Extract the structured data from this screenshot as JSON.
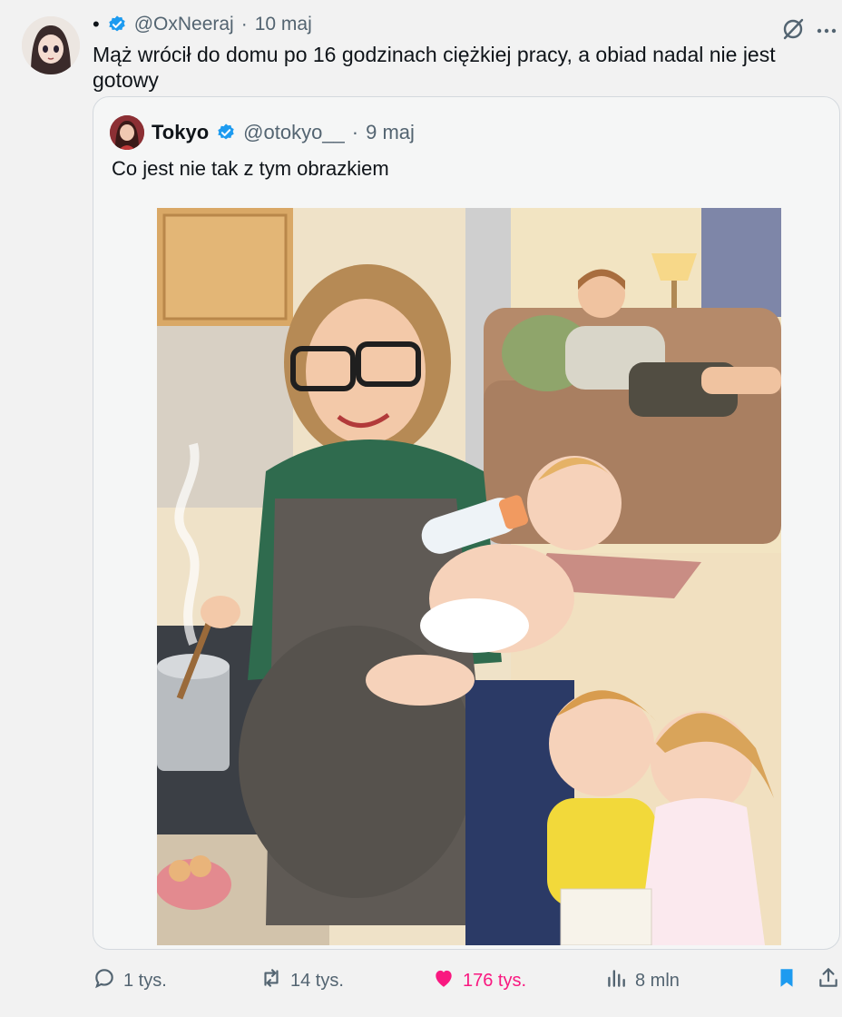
{
  "post": {
    "bullet": "•",
    "handle": "@OxNeeraj",
    "separator": "·",
    "date": "10 maj",
    "text": "Mąż wrócił do domu po 16 godzinach ciężkiej pracy, a obiad nadal nie jest gotowy"
  },
  "quote": {
    "name": "Tokyo",
    "handle": "@otokyo__",
    "separator": "·",
    "date": "9 maj",
    "text": "Co jest nie tak z tym obrazkiem"
  },
  "actions": {
    "replies": "1 tys.",
    "reposts": "14 tys.",
    "likes": "176 tys.",
    "views": "8 mln"
  },
  "colors": {
    "verified": "#1d9bf0",
    "like": "#f91880",
    "bookmark": "#1d9bf0",
    "secondary_text": "#536471"
  },
  "icons": [
    "verified-badge-icon",
    "grok-icon",
    "more-icon",
    "reply-icon",
    "repost-icon",
    "like-icon",
    "views-icon",
    "bookmark-icon",
    "share-icon"
  ]
}
